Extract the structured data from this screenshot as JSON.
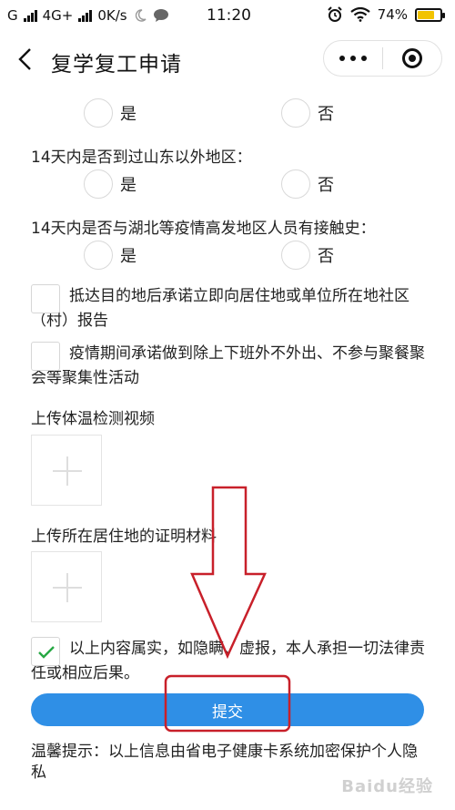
{
  "status_bar": {
    "carrier": "G",
    "network": "4G+",
    "speed": "0K/s",
    "time": "11:20",
    "battery_percent": "74%",
    "battery_level": 0.74,
    "battery_color": "#f2c300"
  },
  "nav": {
    "title": "复学复工申请",
    "back_icon": "chevron-left-icon",
    "more_icon": "more-dots-icon",
    "close_icon": "target-circle-icon"
  },
  "form": {
    "cut_off_label": "",
    "questions": [
      {
        "label": "",
        "yes": "是",
        "no": "否"
      },
      {
        "label": "14天内是否到过山东以外地区：",
        "yes": "是",
        "no": "否"
      },
      {
        "label": "14天内是否与湖北等疫情高发地区人员有接触史：",
        "yes": "是",
        "no": "否"
      }
    ],
    "promises": [
      {
        "text": "抵达目的地后承诺立即向居住地或单位所在地社区（村）报告",
        "checked": false
      },
      {
        "text": "疫情期间承诺做到除上下班外不外出、不参与聚餐聚会等聚集性活动",
        "checked": false
      }
    ],
    "uploads": [
      {
        "label": "上传体温检测视频",
        "icon": "plus-icon"
      },
      {
        "label": "上传所在居住地的证明材料",
        "icon": "plus-icon"
      }
    ],
    "declaration": {
      "text": "以上内容属实，如隐瞒、虚报，本人承担一切法律责任或相应后果。",
      "checked": true
    },
    "submit_label": "提交",
    "tip": "温馨提示：以上信息由省电子健康卡系统加密保护个人隐私"
  },
  "colors": {
    "accent": "#2f8fe6",
    "annotation": "#c8202a",
    "check": "#27a844"
  },
  "watermark": "Baidu经验"
}
